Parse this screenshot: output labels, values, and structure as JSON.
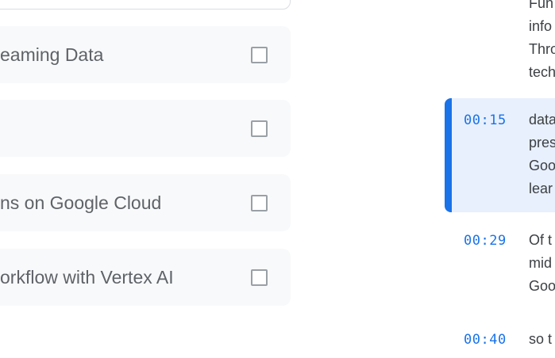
{
  "outline": {
    "items": [
      {
        "label": "eaming Data"
      },
      {
        "label": ""
      },
      {
        "label": "ns on Google Cloud"
      },
      {
        "label": "orkflow with Vertex AI"
      }
    ]
  },
  "transcript": {
    "segments": [
      {
        "time": "",
        "lines": [
          "Fun",
          "info",
          "Thro",
          "tech"
        ]
      },
      {
        "time": "00:15",
        "lines": [
          "data",
          "pres",
          "Goo",
          "lear"
        ],
        "active": true
      },
      {
        "time": "00:29",
        "lines": [
          "Of t",
          "mid",
          "Goo"
        ]
      },
      {
        "time": "00:40",
        "lines": [
          "so t"
        ]
      }
    ]
  },
  "colors": {
    "accent": "#1a73e8",
    "active_bg": "#e8f0fe",
    "item_bg": "#f8f9fa"
  }
}
